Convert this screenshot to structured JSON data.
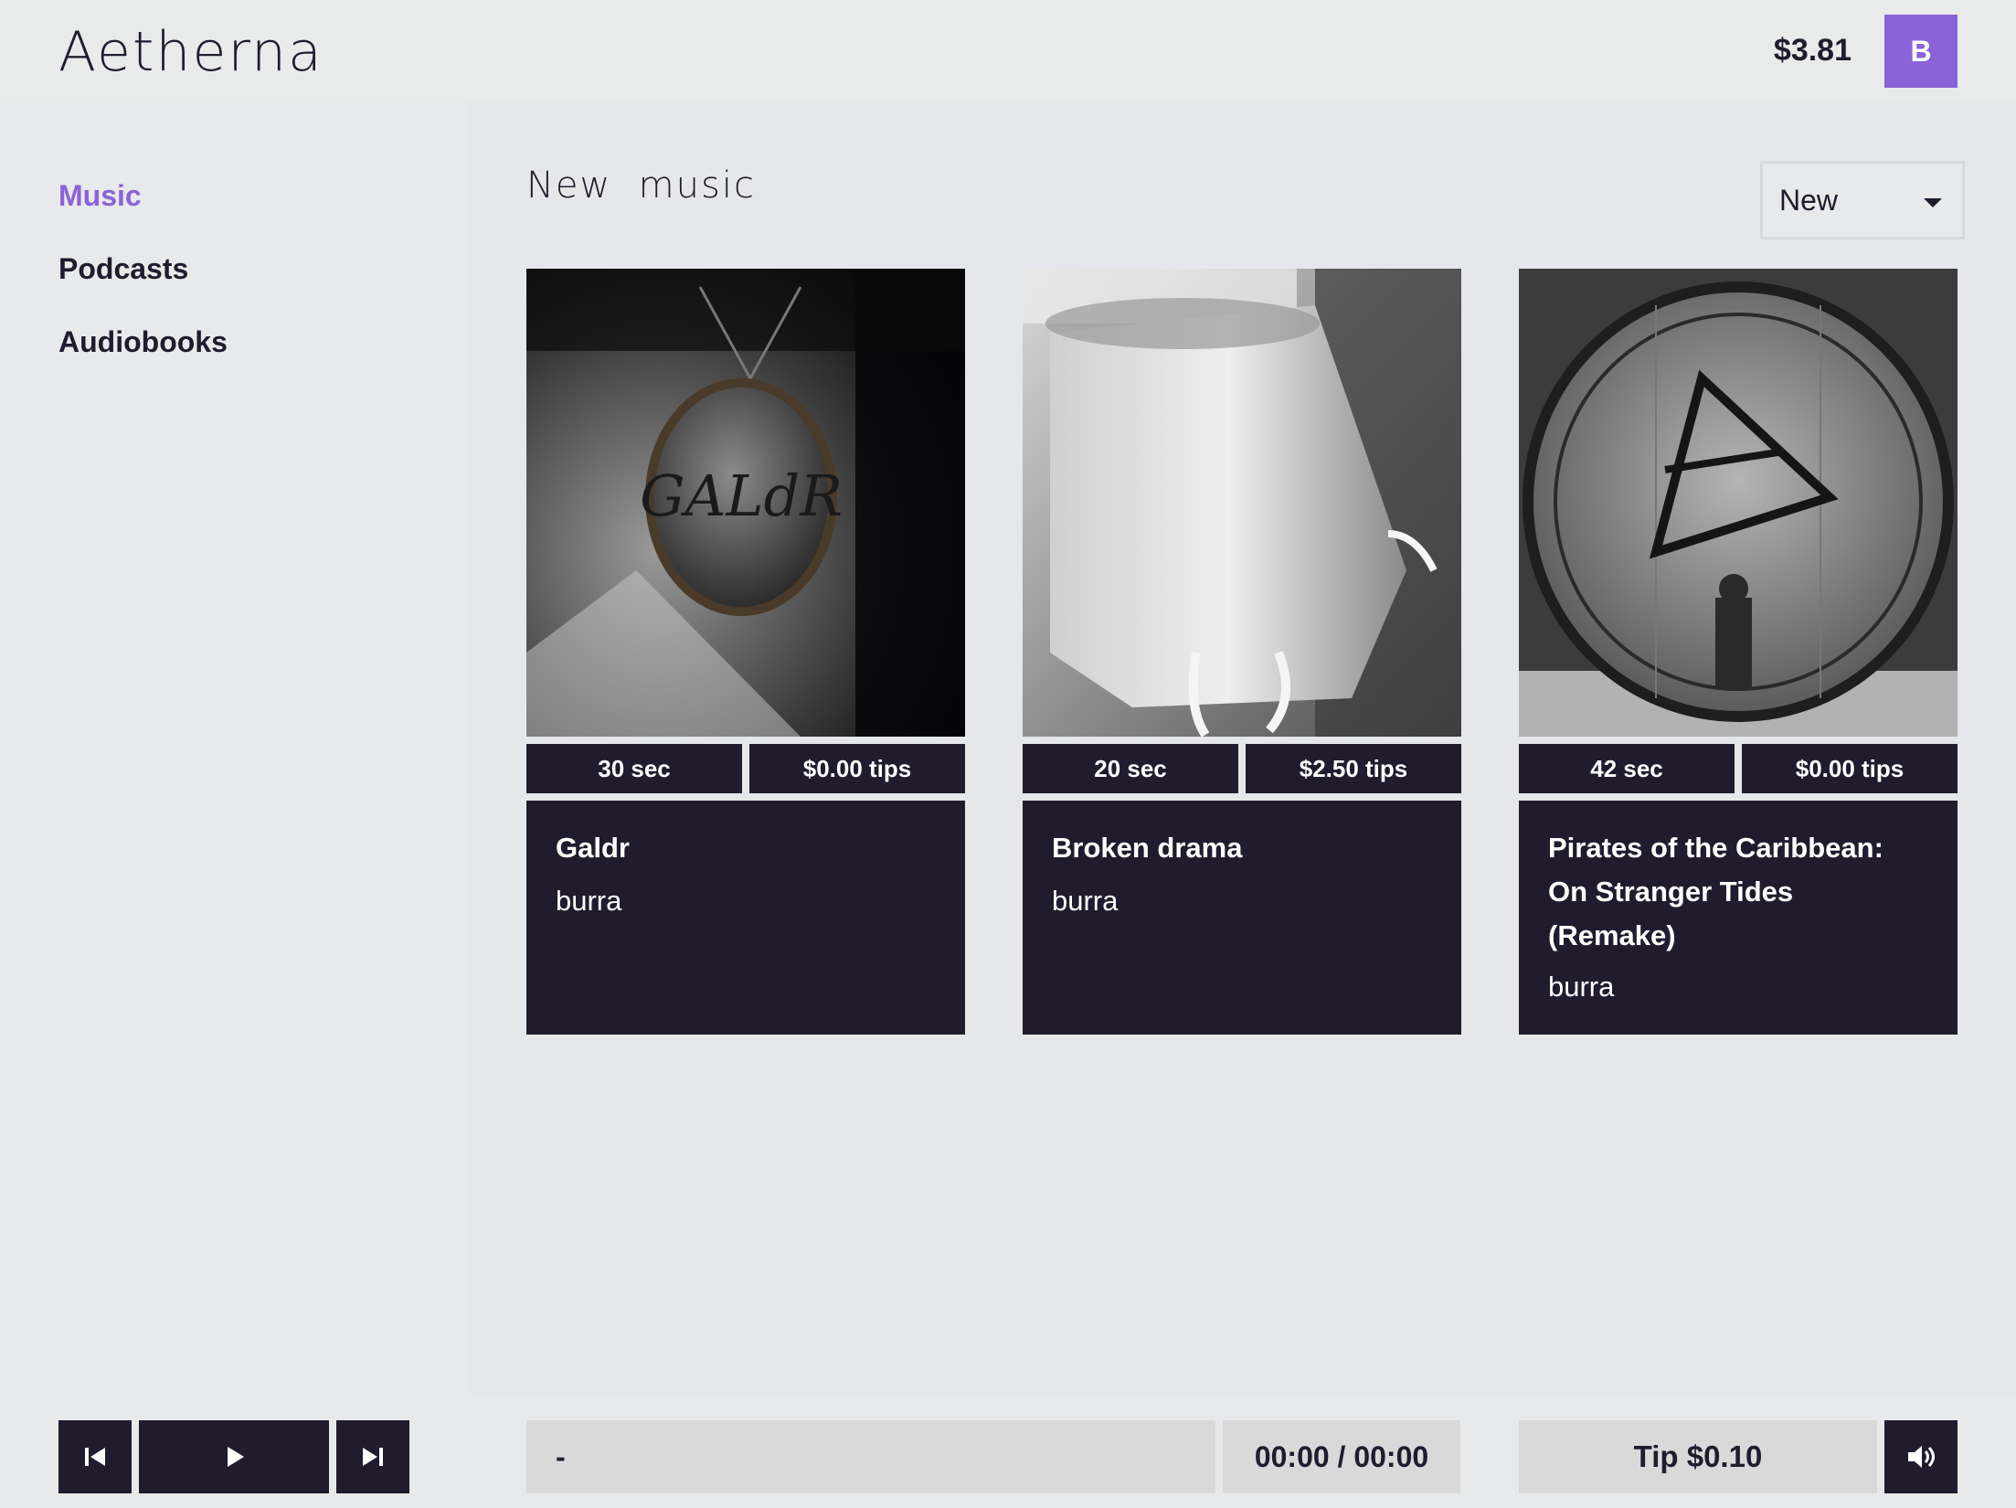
{
  "header": {
    "logo": "Aetherna",
    "balance": "$3.81",
    "avatar_initial": "B"
  },
  "sidebar": {
    "items": [
      {
        "label": "Music",
        "active": true
      },
      {
        "label": "Podcasts",
        "active": false
      },
      {
        "label": "Audiobooks",
        "active": false
      }
    ]
  },
  "main": {
    "section_title": "New  music",
    "sort": {
      "selected": "New"
    }
  },
  "tracks": [
    {
      "duration": "30 sec",
      "tips": "$0.00 tips",
      "title": "Galdr",
      "artist": "burra",
      "cover_icon": "galdr-cover-image"
    },
    {
      "duration": "20 sec",
      "tips": "$2.50 tips",
      "title": "Broken drama",
      "artist": "burra",
      "cover_icon": "bucket-cover-image"
    },
    {
      "duration": "42 sec",
      "tips": "$0.00 tips",
      "title": "Pirates of the Caribbean: On Stranger Tides (Remake)",
      "artist": "burra",
      "cover_icon": "barrel-cover-image"
    }
  ],
  "player": {
    "track_name": "-",
    "time": "00:00 / 00:00",
    "tip_label": "Tip $0.10",
    "icons": {
      "prev": "skip-previous-icon",
      "play": "play-icon",
      "next": "skip-next-icon",
      "volume": "volume-icon"
    }
  },
  "colors": {
    "accent": "#8a63d8",
    "dark": "#201c2e",
    "background": "#e7e8ea",
    "control_gray": "#d9d9da"
  }
}
